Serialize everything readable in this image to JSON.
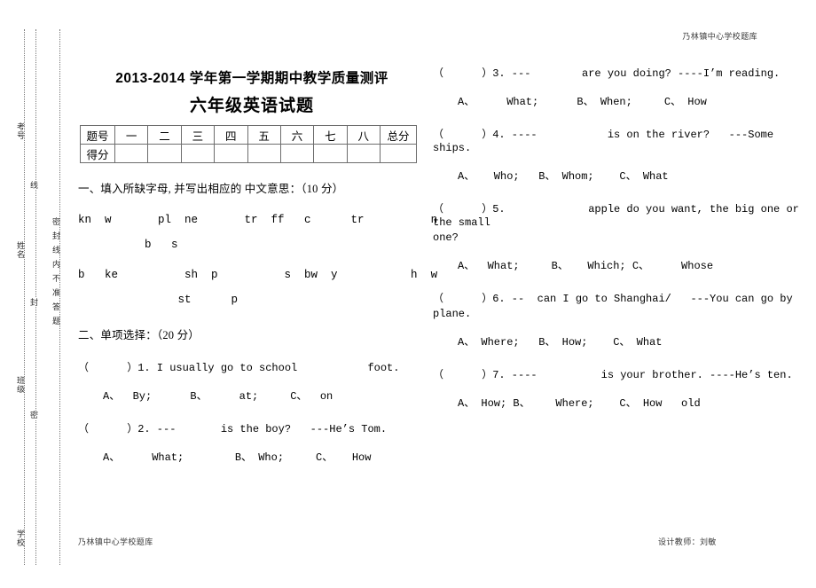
{
  "header": {
    "running_head": "乃林镇中心学校题库"
  },
  "footer": {
    "left": "乃林镇中心学校题库",
    "right": "设计教师：刘敏"
  },
  "seal_margin": {
    "labels": [
      "考号",
      "姓名",
      "班级",
      "学校"
    ],
    "mid_column": [
      "线",
      "封",
      "密"
    ],
    "warning": "密封线内不准答题"
  },
  "titles": {
    "main": "2013-2014 学年第一学期期中教学质量测评",
    "sub": "六年级英语试题"
  },
  "score_table": {
    "row_labels": [
      "题号",
      "得分"
    ],
    "columns": [
      "一",
      "二",
      "三",
      "四",
      "五",
      "六",
      "七",
      "八",
      "总分"
    ],
    "scores": [
      "",
      "",
      "",
      "",
      "",
      "",
      "",
      "",
      ""
    ]
  },
  "section_one": {
    "heading": "一、填入所缺字母, 并写出相应的  中文意思：（10 分）",
    "lines": [
      "kn  w       pl  ne       tr  ff   c      tr          n",
      "          b   s",
      "b   ke          sh  p          s  bw  y           h  w",
      "               st      p"
    ]
  },
  "section_two": {
    "heading": "二、单项选择：（20 分）",
    "questions": [
      {
        "stem": "（      ）1. I usually go to school           foot.",
        "stem_wrap": "",
        "options": "A、  By;      B、     at;     C、  on"
      },
      {
        "stem": "（      ）2. ---       is the boy?   ---He’s Tom.",
        "stem_wrap": "",
        "options": "A、     What;        B、 Who;     C、   How"
      },
      {
        "stem": "（      ）3. ---        are you doing? ----I’m reading.",
        "stem_wrap": "",
        "options": "A、     What;      B、 When;     C、 How"
      },
      {
        "stem": "（      ）4. ----           is on the river?   ---Some ships.",
        "stem_wrap": "",
        "options": "A、   Who;   B、 Whom;    C、 What"
      },
      {
        "stem": "（      ）5.             apple do you want, the big one or the small",
        "stem_wrap": "one?",
        "options": "A、  What;     B、   Which; C、     Whose"
      },
      {
        "stem": "（      ）6. --  can I go to Shanghai/   ---You can go by",
        "stem_wrap": "plane.",
        "options": "A、 Where;   B、 How;    C、 What"
      },
      {
        "stem": "（      ）7. ----          is your brother. ----He’s ten.",
        "stem_wrap": "",
        "options": "A、 How; B、    Where;    C、 How   old"
      }
    ]
  }
}
